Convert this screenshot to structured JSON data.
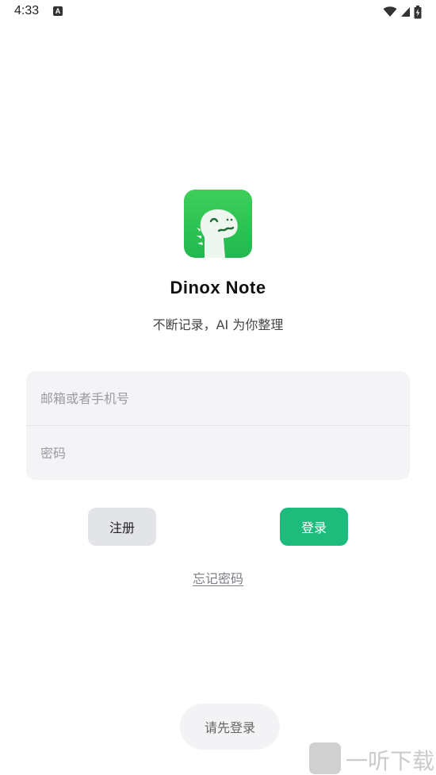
{
  "status_bar": {
    "time": "4:33",
    "notification_icon": "a-badge-icon",
    "icons": [
      "wifi-icon",
      "cellular-signal-icon",
      "battery-charging-icon"
    ]
  },
  "app": {
    "name": "Dinox Note",
    "tagline": "不断记录，AI 为你整理",
    "logo_icon": "dinosaur-logo-icon",
    "brand_color": "#1dbb7c"
  },
  "form": {
    "email_placeholder": "邮箱或者手机号",
    "password_placeholder": "密码"
  },
  "buttons": {
    "register_label": "注册",
    "login_label": "登录"
  },
  "forgot_password_label": "忘记密码",
  "toast": {
    "message": "请先登录"
  },
  "watermark": {
    "text": "一听下载"
  }
}
